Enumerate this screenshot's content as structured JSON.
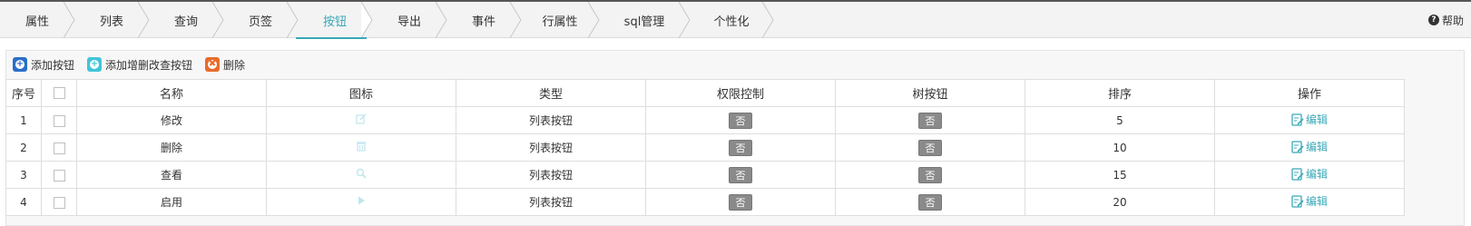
{
  "tabs": [
    {
      "label": "属性",
      "active": false
    },
    {
      "label": "列表",
      "active": false
    },
    {
      "label": "查询",
      "active": false
    },
    {
      "label": "页签",
      "active": false
    },
    {
      "label": "按钮",
      "active": true
    },
    {
      "label": "导出",
      "active": false
    },
    {
      "label": "事件",
      "active": false
    },
    {
      "label": "行属性",
      "active": false
    },
    {
      "label": "sql管理",
      "active": false
    },
    {
      "label": "个性化",
      "active": false
    }
  ],
  "help": {
    "label": "帮助",
    "icon": "question-circle-icon"
  },
  "toolbar": {
    "add_button": {
      "label": "添加按钮",
      "icon": "plus-circle-icon",
      "color": "#2a6fc7"
    },
    "add_crud_button": {
      "label": "添加增删改查按钮",
      "icon": "plus-circle-icon",
      "color": "#42c4d8"
    },
    "delete_button": {
      "label": "删除",
      "icon": "gear-delete-icon",
      "color": "#e86b2a"
    }
  },
  "table": {
    "headers": {
      "index": "序号",
      "name": "名称",
      "icon": "图标",
      "type": "类型",
      "permission": "权限控制",
      "tree_button": "树按钮",
      "sort": "排序",
      "action": "操作"
    },
    "rows": [
      {
        "index": "1",
        "name": "修改",
        "icon": "edit-icon",
        "type": "列表按钮",
        "permission": "否",
        "tree_button": "否",
        "sort": "5",
        "action": "编辑"
      },
      {
        "index": "2",
        "name": "删除",
        "icon": "trash-icon",
        "type": "列表按钮",
        "permission": "否",
        "tree_button": "否",
        "sort": "10",
        "action": "编辑"
      },
      {
        "index": "3",
        "name": "查看",
        "icon": "search-icon",
        "type": "列表按钮",
        "permission": "否",
        "tree_button": "否",
        "sort": "15",
        "action": "编辑"
      },
      {
        "index": "4",
        "name": "启用",
        "icon": "play-icon",
        "type": "列表按钮",
        "permission": "否",
        "tree_button": "否",
        "sort": "20",
        "action": "编辑"
      }
    ]
  },
  "colors": {
    "accent": "#3aa8b8",
    "badge": "#8a8a8a"
  }
}
